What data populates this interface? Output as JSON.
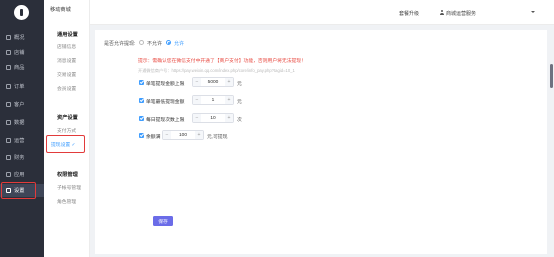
{
  "sidebar": {
    "items": [
      {
        "label": "概况",
        "icon": "overview-icon"
      },
      {
        "label": "店铺",
        "icon": "store-icon"
      },
      {
        "label": "商品",
        "icon": "goods-icon"
      },
      {
        "label": "订单",
        "icon": "order-icon"
      },
      {
        "label": "客户",
        "icon": "customer-icon"
      },
      {
        "label": "数据",
        "icon": "data-icon"
      },
      {
        "label": "运营",
        "icon": "operation-icon"
      },
      {
        "label": "财务",
        "icon": "finance-icon"
      },
      {
        "label": "应用",
        "icon": "apps-icon"
      },
      {
        "label": "设置",
        "icon": "settings-icon"
      }
    ],
    "active_index": 9
  },
  "subnav": {
    "app_name": "移动商城",
    "groups": [
      {
        "title": "通用设置",
        "items": [
          "店铺信息",
          "消息设置",
          "交易设置",
          "会员设置"
        ]
      },
      {
        "title": "资产设置",
        "items": [
          "支付方式",
          "提现设置"
        ]
      },
      {
        "title": "权限管理",
        "items": [
          "子帐号管理",
          "角色管理"
        ]
      }
    ],
    "active_item": "提现设置"
  },
  "topbar": {
    "upgrade": "套餐升级",
    "user": "商城运营服务"
  },
  "form": {
    "allow_label": "是否允许提现:",
    "options": [
      "不允许",
      "允许"
    ],
    "selected_option": "允许",
    "warning": "提示：需确认您在微信支付中开通了【商户支付】功能，否则用户将无法提现！",
    "hint": "开通微信商户号：https://pay.weixin.qq.com/index.php/core/info_pay.php?tagid=10_1",
    "single_max": {
      "label": "单笔提现金额上限",
      "value": "5000",
      "unit": "元"
    },
    "single_min": {
      "label": "单笔最低提现金额",
      "value": "1",
      "unit": "元"
    },
    "daily_limit": {
      "label": "每日提现次数上限",
      "value": "10",
      "unit": "次"
    },
    "balance": {
      "label": "余额满",
      "value": "100",
      "unit": "元,可提现"
    },
    "save_label": "保存"
  },
  "colors": {
    "primary": "#409eff",
    "sidebar_bg": "#2b2f3a",
    "warning": "#e8483f",
    "save_button": "#6b6ce8"
  }
}
